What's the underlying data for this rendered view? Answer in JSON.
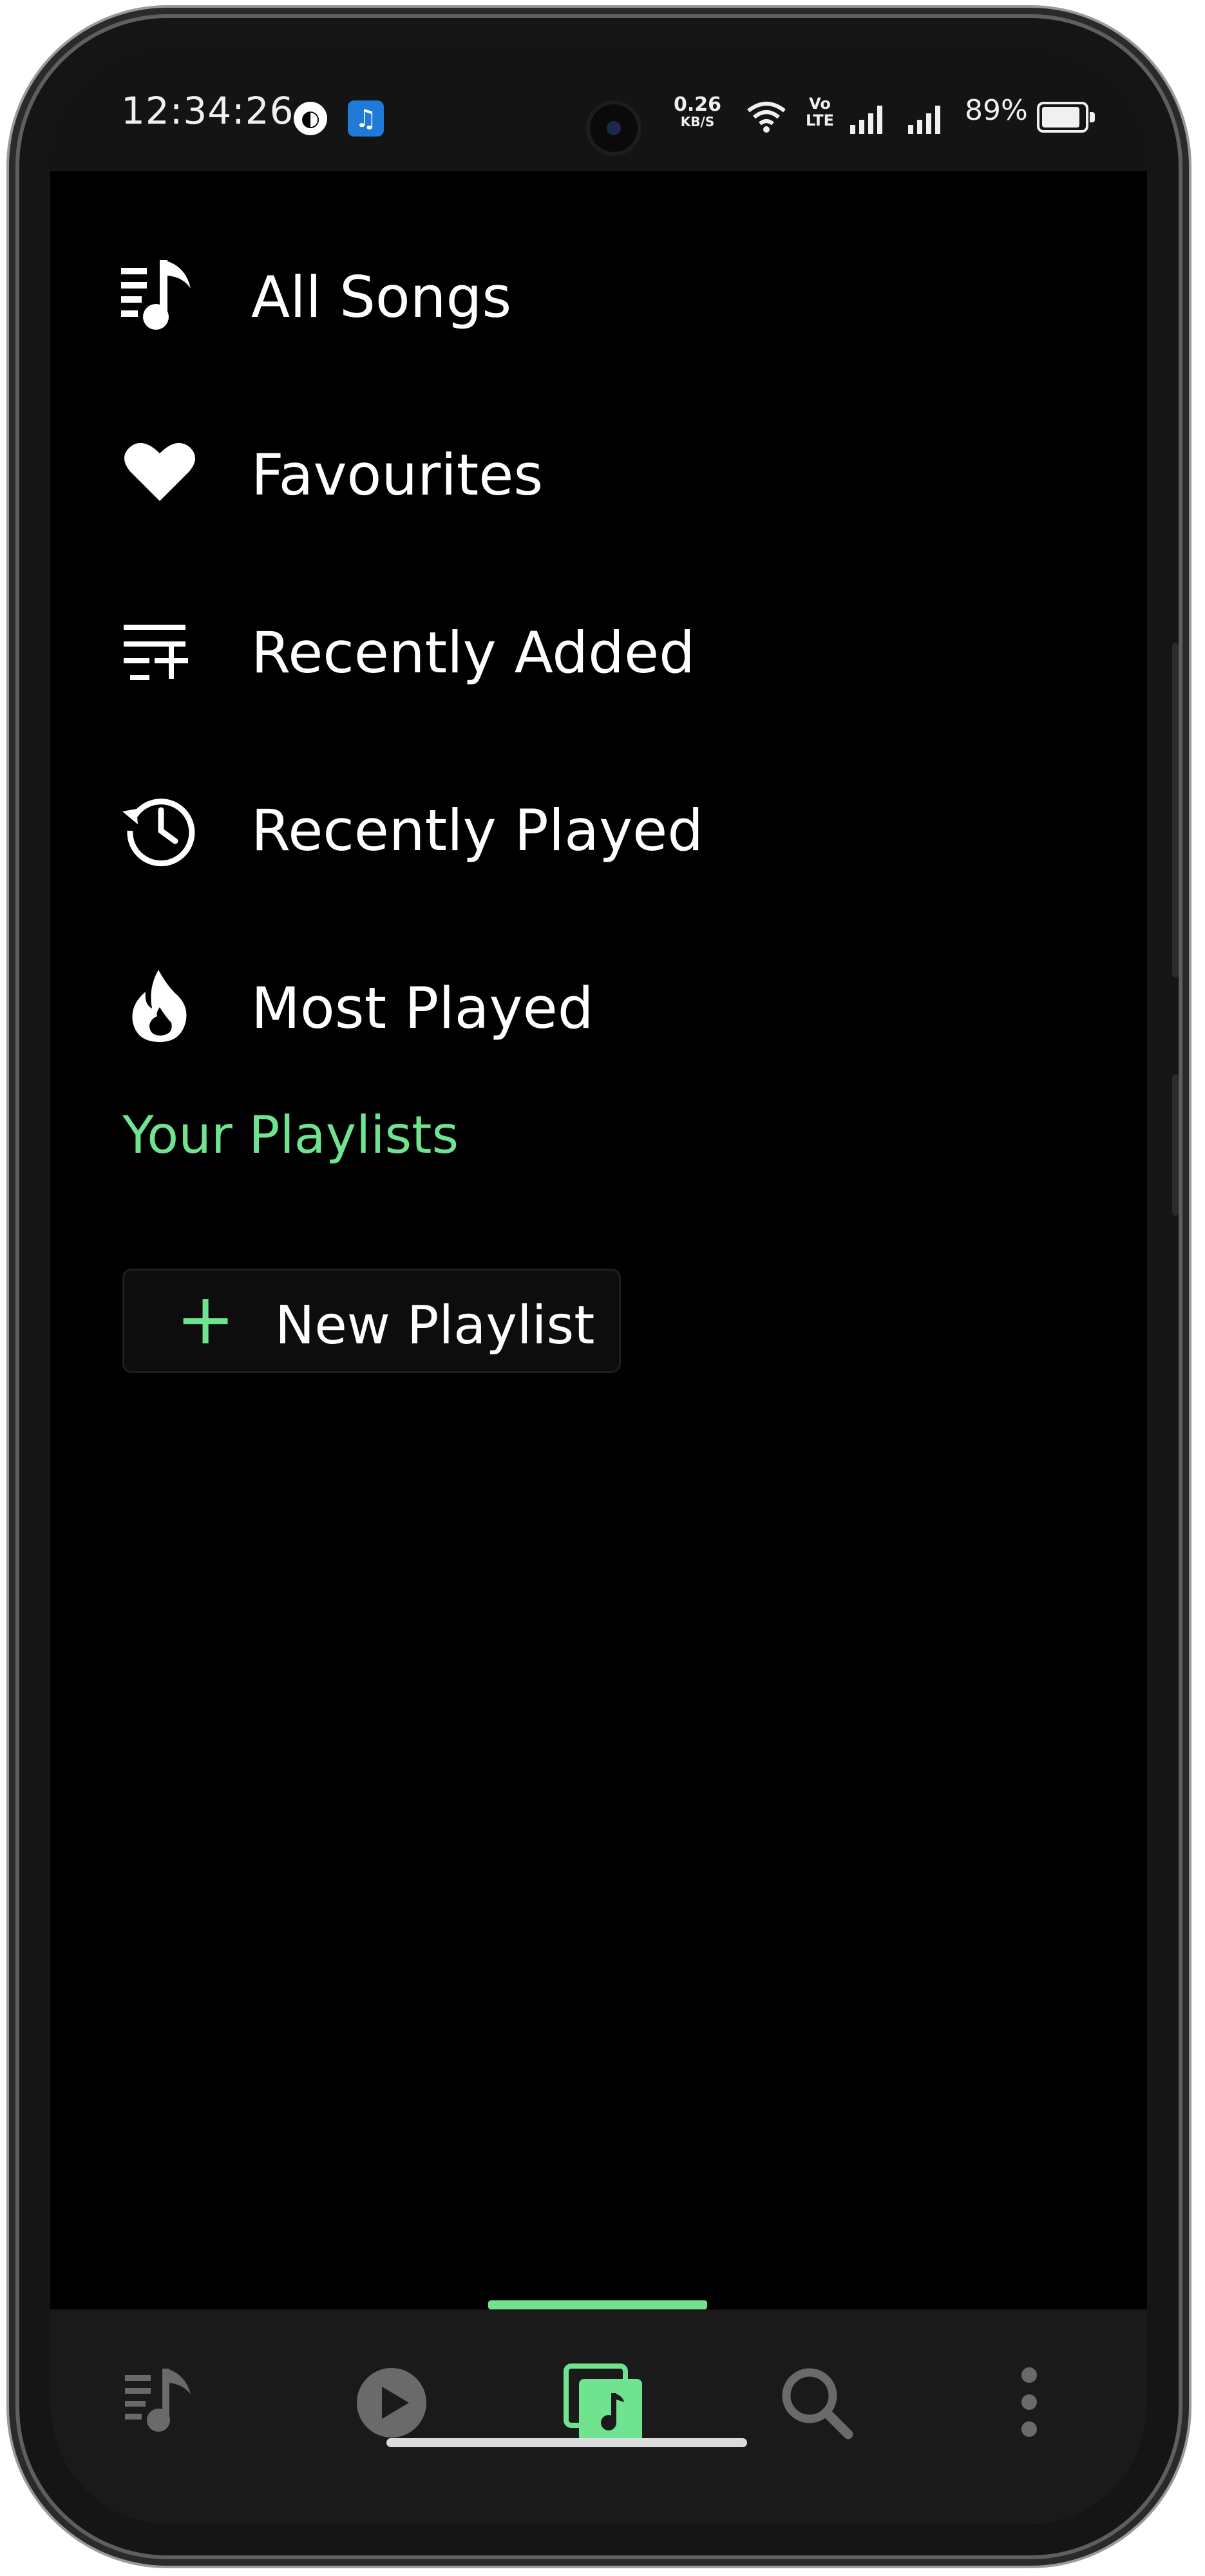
{
  "status_bar": {
    "time": "12:34:26",
    "net_speed_value": "0.26",
    "net_speed_unit": "KB/S",
    "volte_line1": "Vo",
    "volte_line2": "LTE",
    "battery": "89%"
  },
  "menu": {
    "items": [
      {
        "label": "All Songs",
        "icon": "music-list-icon"
      },
      {
        "label": "Favourites",
        "icon": "heart-icon"
      },
      {
        "label": "Recently Added",
        "icon": "playlist-add-icon"
      },
      {
        "label": "Recently Played",
        "icon": "history-icon"
      },
      {
        "label": "Most Played",
        "icon": "fire-icon"
      }
    ]
  },
  "playlists": {
    "section_title": "Your Playlists",
    "new_playlist_label": "New Playlist"
  },
  "bottom_nav": {
    "tabs": [
      {
        "name": "songs",
        "icon": "music-list-icon",
        "active": false
      },
      {
        "name": "now-playing",
        "icon": "play-circle-icon",
        "active": false
      },
      {
        "name": "library",
        "icon": "library-music-icon",
        "active": true
      },
      {
        "name": "search",
        "icon": "search-icon",
        "active": false
      },
      {
        "name": "more",
        "icon": "more-vertical-icon",
        "active": false
      }
    ]
  },
  "colors": {
    "accent": "#6fe38f",
    "background": "#000000",
    "nav_background": "#1a1a1a",
    "text": "#ffffff"
  }
}
